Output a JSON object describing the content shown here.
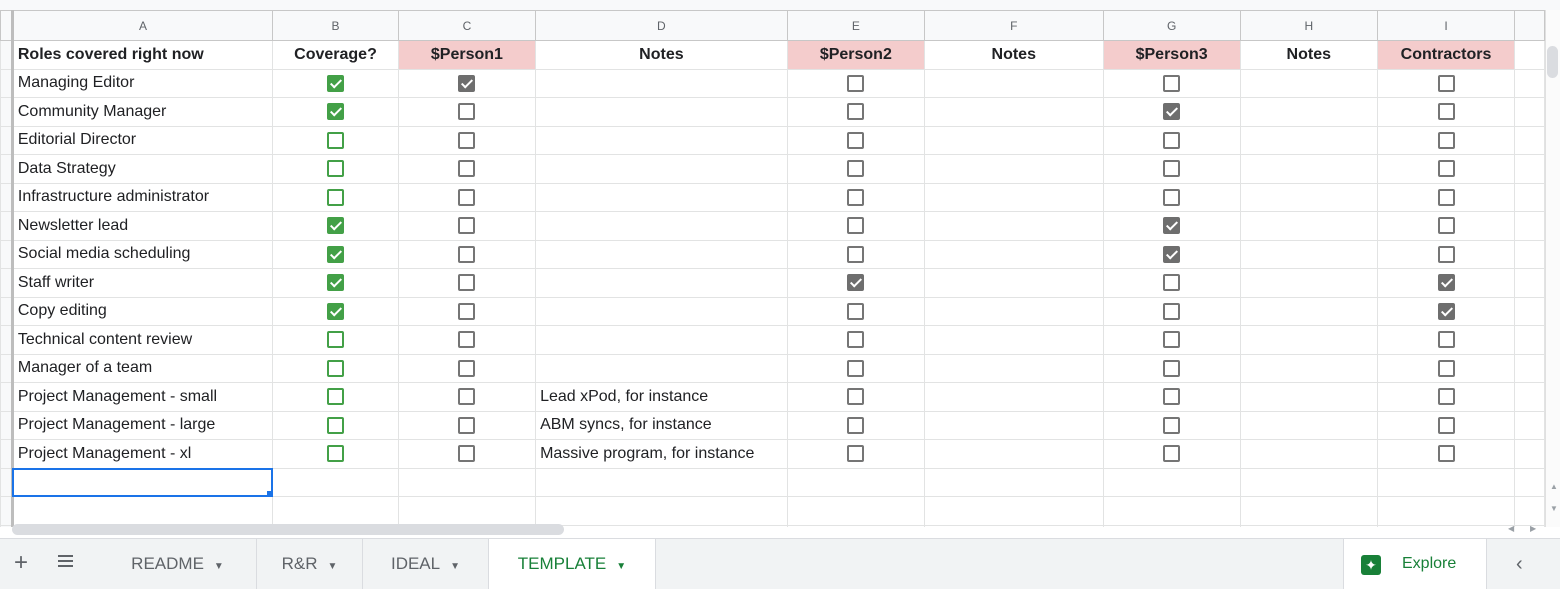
{
  "column_letters": [
    "A",
    "B",
    "C",
    "D",
    "E",
    "F",
    "G",
    "H",
    "I"
  ],
  "header_row": [
    "Roles covered right now",
    "Coverage?",
    "$Person1",
    "Notes",
    "$Person2",
    "Notes",
    "$Person3",
    "Notes",
    "Contractors"
  ],
  "accent_colors": {
    "pink_header": "#f4cccc",
    "check_green": "#43a047",
    "tab_active": "#188038",
    "selection": "#1a73e8"
  },
  "rows": [
    {
      "role": "Managing Editor",
      "coverage": true,
      "p1": true,
      "notes1": "",
      "p2": false,
      "notes2": "",
      "p3": false,
      "notes3": "",
      "contractors": false
    },
    {
      "role": "Community Manager",
      "coverage": true,
      "p1": false,
      "notes1": "",
      "p2": false,
      "notes2": "",
      "p3": true,
      "notes3": "",
      "contractors": false
    },
    {
      "role": "Editorial Director",
      "coverage": false,
      "p1": false,
      "notes1": "",
      "p2": false,
      "notes2": "",
      "p3": false,
      "notes3": "",
      "contractors": false
    },
    {
      "role": "Data Strategy",
      "coverage": false,
      "p1": false,
      "notes1": "",
      "p2": false,
      "notes2": "",
      "p3": false,
      "notes3": "",
      "contractors": false
    },
    {
      "role": "Infrastructure administrator",
      "coverage": false,
      "p1": false,
      "notes1": "",
      "p2": false,
      "notes2": "",
      "p3": false,
      "notes3": "",
      "contractors": false
    },
    {
      "role": "Newsletter lead",
      "coverage": true,
      "p1": false,
      "notes1": "",
      "p2": false,
      "notes2": "",
      "p3": true,
      "notes3": "",
      "contractors": false
    },
    {
      "role": "Social media scheduling",
      "coverage": true,
      "p1": false,
      "notes1": "",
      "p2": false,
      "notes2": "",
      "p3": true,
      "notes3": "",
      "contractors": false
    },
    {
      "role": "Staff writer",
      "coverage": true,
      "p1": false,
      "notes1": "",
      "p2": true,
      "notes2": "",
      "p3": false,
      "notes3": "",
      "contractors": true
    },
    {
      "role": "Copy editing",
      "coverage": true,
      "p1": false,
      "notes1": "",
      "p2": false,
      "notes2": "",
      "p3": false,
      "notes3": "",
      "contractors": true
    },
    {
      "role": "Technical content review",
      "coverage": false,
      "p1": false,
      "notes1": "",
      "p2": false,
      "notes2": "",
      "p3": false,
      "notes3": "",
      "contractors": false
    },
    {
      "role": "Manager of a team",
      "coverage": false,
      "p1": false,
      "notes1": "",
      "p2": false,
      "notes2": "",
      "p3": false,
      "notes3": "",
      "contractors": false
    },
    {
      "role": "Project Management - small",
      "coverage": false,
      "p1": false,
      "notes1": "Lead xPod, for instance",
      "p2": false,
      "notes2": "",
      "p3": false,
      "notes3": "",
      "contractors": false
    },
    {
      "role": "Project Management - large",
      "coverage": false,
      "p1": false,
      "notes1": "ABM syncs, for instance",
      "p2": false,
      "notes2": "",
      "p3": false,
      "notes3": "",
      "contractors": false
    },
    {
      "role": "Project Management - xl",
      "coverage": false,
      "p1": false,
      "notes1": "Massive program, for instance",
      "p2": false,
      "notes2": "",
      "p3": false,
      "notes3": "",
      "contractors": false
    }
  ],
  "tabs": [
    {
      "label": "README",
      "active": false
    },
    {
      "label": "R&R",
      "active": false
    },
    {
      "label": "IDEAL",
      "active": false
    },
    {
      "label": "TEMPLATE",
      "active": true
    }
  ],
  "tabbar": {
    "add_icon": "plus-icon",
    "list_icon": "menu-icon",
    "explore_label": "Explore",
    "explore_icon": "explore-icon",
    "collapse_icon": "chevron-left-icon"
  }
}
